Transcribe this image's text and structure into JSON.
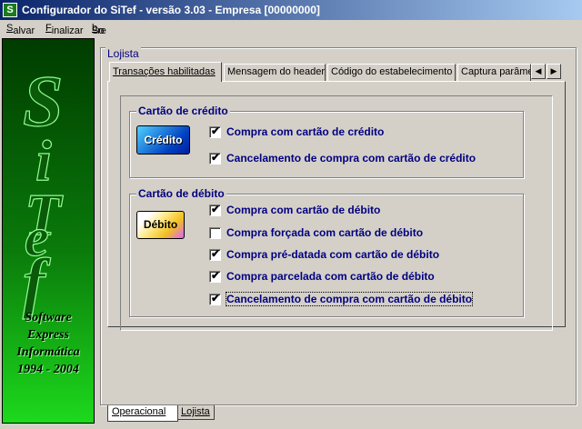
{
  "window": {
    "icon_glyph": "S",
    "title": "Configurador do SiTef - versão 3.03 - Empresa [00000000]"
  },
  "menu": {
    "items": [
      {
        "pre": "",
        "u": "S",
        "post": "alvar"
      },
      {
        "pre": "",
        "u": "F",
        "post": "inalizar"
      },
      {
        "pre": "So",
        "u": "b",
        "post": "re"
      }
    ]
  },
  "sidebar": {
    "logo_letters": [
      "S",
      "i",
      "T",
      "e",
      "f"
    ],
    "brand_lines": [
      "Software",
      "Express",
      "Informática",
      "1994 - 2004"
    ],
    "colors": {
      "top": "#003c00",
      "bottom": "#1dd91d"
    }
  },
  "lojista": {
    "frame_label": "Lojista",
    "tabs": [
      "Transações habilitadas",
      "Mensagem do header",
      "Código do estabelecimento",
      "Captura parâmetros"
    ],
    "scroll_left_icon": "left-arrow-icon",
    "scroll_right_icon": "right-arrow-icon",
    "scroll_left_glyph": "◀",
    "scroll_right_glyph": "▶"
  },
  "credit": {
    "label": "Cartão de crédito",
    "card_text": "Crédito",
    "options": [
      {
        "label": "Compra com cartão de crédito",
        "checked": true
      },
      {
        "label": "Cancelamento de compra com cartão de crédito",
        "checked": true
      }
    ]
  },
  "debit": {
    "label": "Cartão de débito",
    "card_text": "Débito",
    "options": [
      {
        "label": "Compra com cartão de débito",
        "checked": true
      },
      {
        "label": "Compra forçada com cartão de débito",
        "checked": false
      },
      {
        "label": "Compra pré-datada com cartão de débito",
        "checked": true
      },
      {
        "label": "Compra parcelada com cartão de débito",
        "checked": true
      },
      {
        "label": "Cancelamento de compra com cartão de débito",
        "checked": true
      }
    ]
  },
  "bottom_tabs": [
    "Operacional",
    "Lojista"
  ],
  "check_glyph": "✔"
}
